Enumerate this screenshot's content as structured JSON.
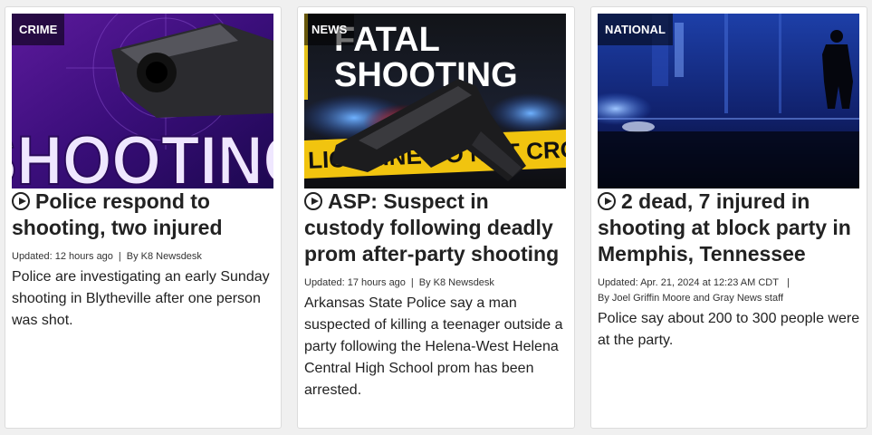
{
  "cards": [
    {
      "label": "CRIME",
      "image_text": "SHOOTING",
      "headline": "Police respond to shooting, two injured",
      "updated": "Updated: 12 hours ago",
      "separator": "|",
      "byline": "By K8 Newsdesk",
      "summary": "Police are investigating an early Sunday shooting in Blytheville after one person was shot."
    },
    {
      "label": "NEWS",
      "image_text_1": "FATAL",
      "image_text_2": "SHOOTING",
      "image_tape": "LICE LINE DO NOT CROSS",
      "headline": "ASP: Suspect in custody following deadly prom after-party shooting",
      "updated": "Updated: 17 hours ago",
      "separator": "|",
      "byline": "By K8 Newsdesk",
      "summary": "Arkansas State Police say a man suspected of killing a teenager outside a party following the Helena-West Helena Central High School prom has been arrested."
    },
    {
      "label": "NATIONAL",
      "headline": "2 dead, 7 injured in shooting at block party in Memphis, Tennessee",
      "updated": "Updated: Apr. 21, 2024 at 12:23 AM CDT",
      "separator": "|",
      "byline": "By Joel Griffin Moore and Gray News staff",
      "summary": "Police say about 200 to 300 people were at the party."
    }
  ]
}
